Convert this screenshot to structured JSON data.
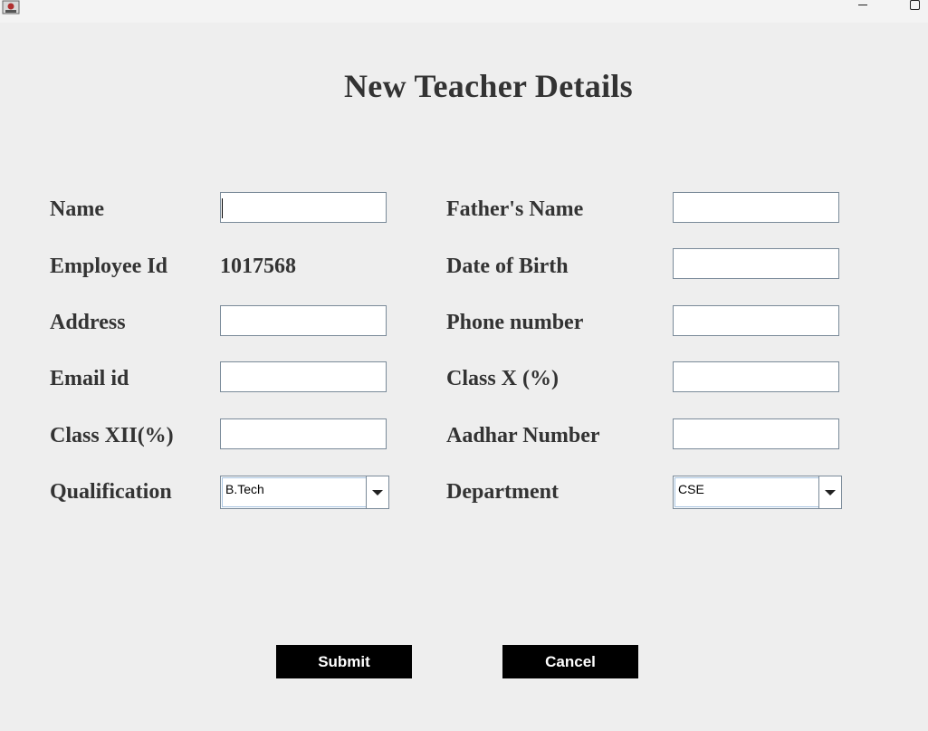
{
  "window": {
    "title_icon": "java-app-icon",
    "minimize_icon": "minimize-icon",
    "maximize_icon": "maximize-icon"
  },
  "page": {
    "title": "New Teacher Details"
  },
  "form": {
    "name_label": "Name",
    "name_value": "",
    "fathers_name_label": "Father's Name",
    "fathers_name_value": "",
    "employee_id_label": "Employee Id",
    "employee_id_value": "1017568",
    "dob_label": "Date of Birth",
    "dob_value": "",
    "address_label": "Address",
    "address_value": "",
    "phone_label": "Phone number",
    "phone_value": "",
    "email_label": "Email id",
    "email_value": "",
    "class_x_label": "Class X (%)",
    "class_x_value": "",
    "class_xii_label": "Class XII(%)",
    "class_xii_value": "",
    "aadhar_label": "Aadhar Number",
    "aadhar_value": "",
    "qualification_label": "Qualification",
    "qualification_selected": "B.Tech",
    "department_label": "Department",
    "department_selected": "CSE"
  },
  "actions": {
    "submit_label": "Submit",
    "cancel_label": "Cancel"
  }
}
